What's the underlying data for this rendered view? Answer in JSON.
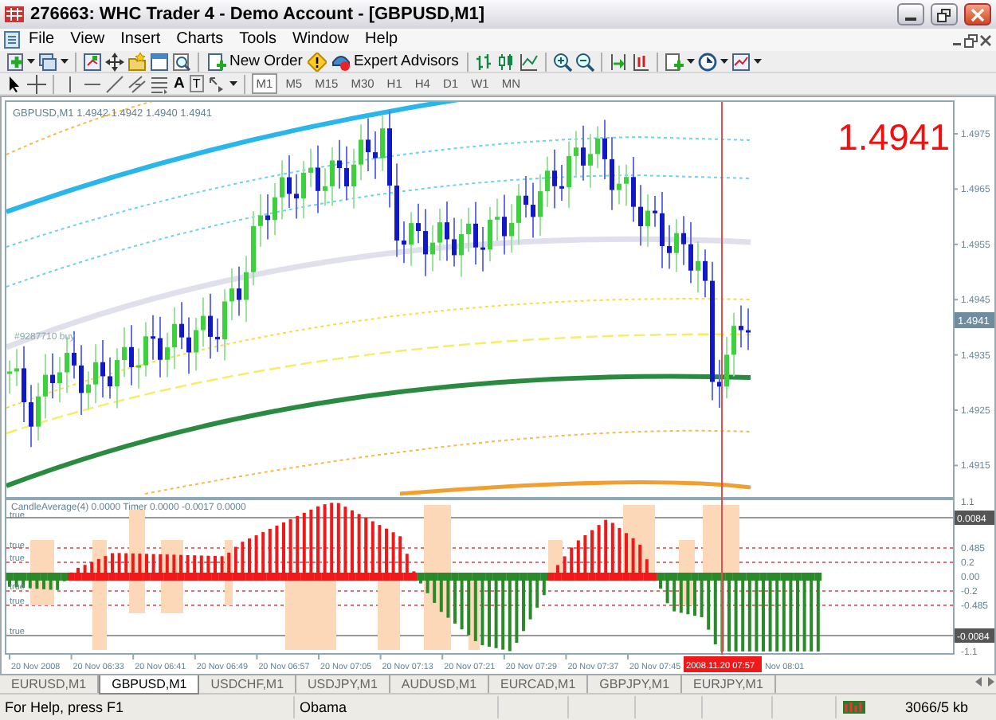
{
  "window": {
    "title": "276663: WHC Trader 4 - Demo Account - [GBPUSD,M1]"
  },
  "menu": [
    "File",
    "View",
    "Insert",
    "Charts",
    "Tools",
    "Window",
    "Help"
  ],
  "toolbar": {
    "new_order": "New Order",
    "expert_advisors": "Expert Advisors",
    "text_tool": "A",
    "label_tool": "T"
  },
  "periods": [
    {
      "label": "M1",
      "selected": true
    },
    {
      "label": "M5",
      "selected": false
    },
    {
      "label": "M15",
      "selected": false
    },
    {
      "label": "M30",
      "selected": false
    },
    {
      "label": "H1",
      "selected": false
    },
    {
      "label": "H4",
      "selected": false
    },
    {
      "label": "D1",
      "selected": false
    },
    {
      "label": "W1",
      "selected": false
    },
    {
      "label": "MN",
      "selected": false
    }
  ],
  "chart": {
    "info": "GBPUSD,M1  1.4942 1.4942 1.4940 1.4941",
    "big_price": "1.4941",
    "order_label": "#9287710 buy",
    "price_ticks": [
      "1.4975",
      "1.4965",
      "1.4955",
      "1.4945",
      "1.4935",
      "1.4925",
      "1.4915"
    ],
    "current_price": "1.4941"
  },
  "indicator": {
    "header": "CandleAverage(4) 0.0000  Timer 0.0000 -0.0017 0.0000",
    "flags": [
      "true",
      "true",
      "true",
      "true",
      "true",
      "true"
    ],
    "ticks": [
      {
        "label": "1.1",
        "kind": "plain"
      },
      {
        "label": "0.0084",
        "kind": "boxed"
      },
      {
        "label": "0.485",
        "kind": "plain"
      },
      {
        "label": "0.2",
        "kind": "plain"
      },
      {
        "label": "0.00",
        "kind": "plain"
      },
      {
        "label": "-0.2",
        "kind": "plain"
      },
      {
        "label": "-0.485",
        "kind": "plain"
      },
      {
        "label": "-0.0084",
        "kind": "boxed"
      },
      {
        "label": "-1.1",
        "kind": "plain"
      }
    ]
  },
  "time_axis": {
    "labels": [
      "20 Nov 2008",
      "20 Nov 06:33",
      "20 Nov 06:41",
      "20 Nov 06:49",
      "20 Nov 06:57",
      "20 Nov 07:05",
      "20 Nov 07:13",
      "20 Nov 07:21",
      "20 Nov 07:29",
      "20 Nov 07:37",
      "20 Nov 07:45"
    ],
    "cursor_time": "2008.11.20 07:57",
    "last_label": "Nov 08:01"
  },
  "tabs": [
    {
      "label": "EURUSD,M1",
      "selected": false
    },
    {
      "label": "GBPUSD,M1",
      "selected": true
    },
    {
      "label": "USDCHF,M1",
      "selected": false
    },
    {
      "label": "USDJPY,M1",
      "selected": false
    },
    {
      "label": "AUDUSD,M1",
      "selected": false
    },
    {
      "label": "EURCAD,M1",
      "selected": false
    },
    {
      "label": "GBPJPY,M1",
      "selected": false
    },
    {
      "label": "EURJPY,M1",
      "selected": false
    }
  ],
  "status_bar": {
    "help": "For Help, press F1",
    "profile": "Obama",
    "traffic": "3066/5 kb"
  }
}
